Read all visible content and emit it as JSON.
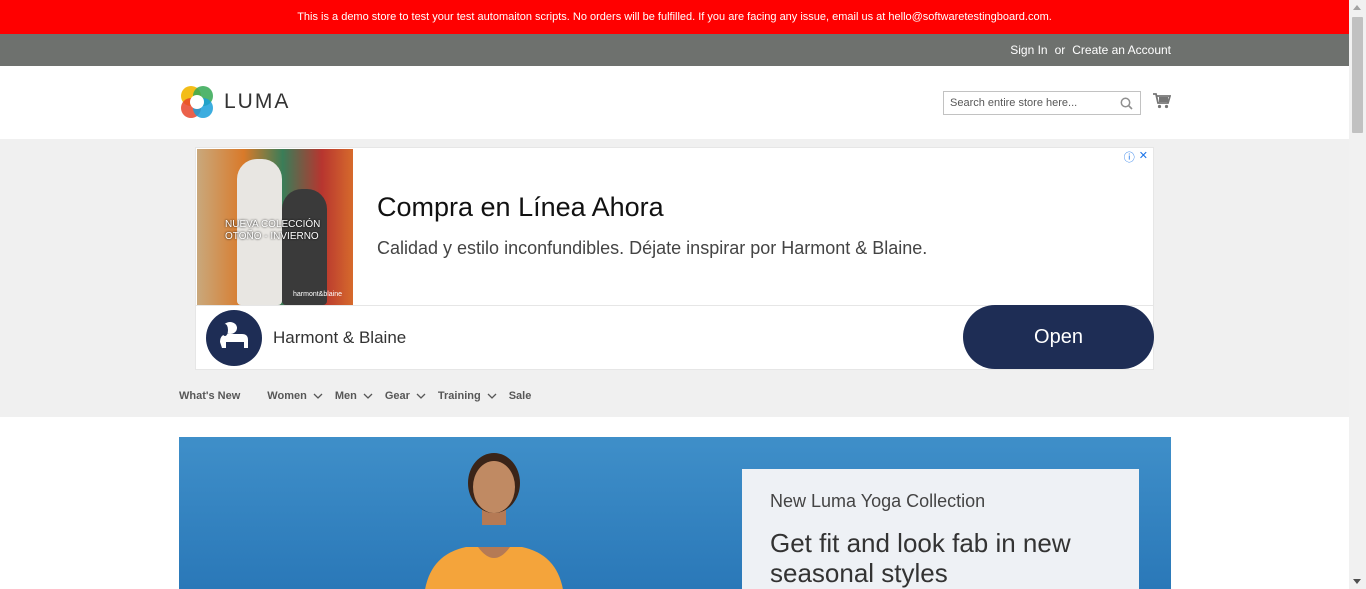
{
  "demo_banner": {
    "text": "This is a demo store to test your test automaiton scripts. No orders will be fulfilled. If you are facing any issue, email us at hello@softwaretestingboard.com."
  },
  "header": {
    "sign_in": "Sign In",
    "or": "or",
    "create_account": "Create an Account",
    "logo_text": "LUMA",
    "search_placeholder": "Search entire store here..."
  },
  "ad": {
    "image_text": "NUEVA COLECCIÓN\nOTOÑO - INVIERNO",
    "image_brand": "harmont&blaine",
    "headline": "Compra en Línea Ahora",
    "description": "Calidad y estilo inconfundibles. Déjate inspirar por Harmont & Blaine.",
    "advertiser": "Harmont & Blaine",
    "cta": "Open",
    "info_glyph": "ⓘ",
    "close_glyph": "✕"
  },
  "nav": {
    "items": [
      {
        "label": "What's New",
        "dropdown": false
      },
      {
        "label": "Women",
        "dropdown": true
      },
      {
        "label": "Men",
        "dropdown": true
      },
      {
        "label": "Gear",
        "dropdown": true
      },
      {
        "label": "Training",
        "dropdown": true
      },
      {
        "label": "Sale",
        "dropdown": false
      }
    ]
  },
  "hero": {
    "subtitle": "New Luma Yoga Collection",
    "title": "Get fit and look fab in new seasonal styles"
  },
  "colors": {
    "banner": "#ff0000",
    "header_panel": "#6e716e",
    "ad_button": "#1e2d55"
  }
}
